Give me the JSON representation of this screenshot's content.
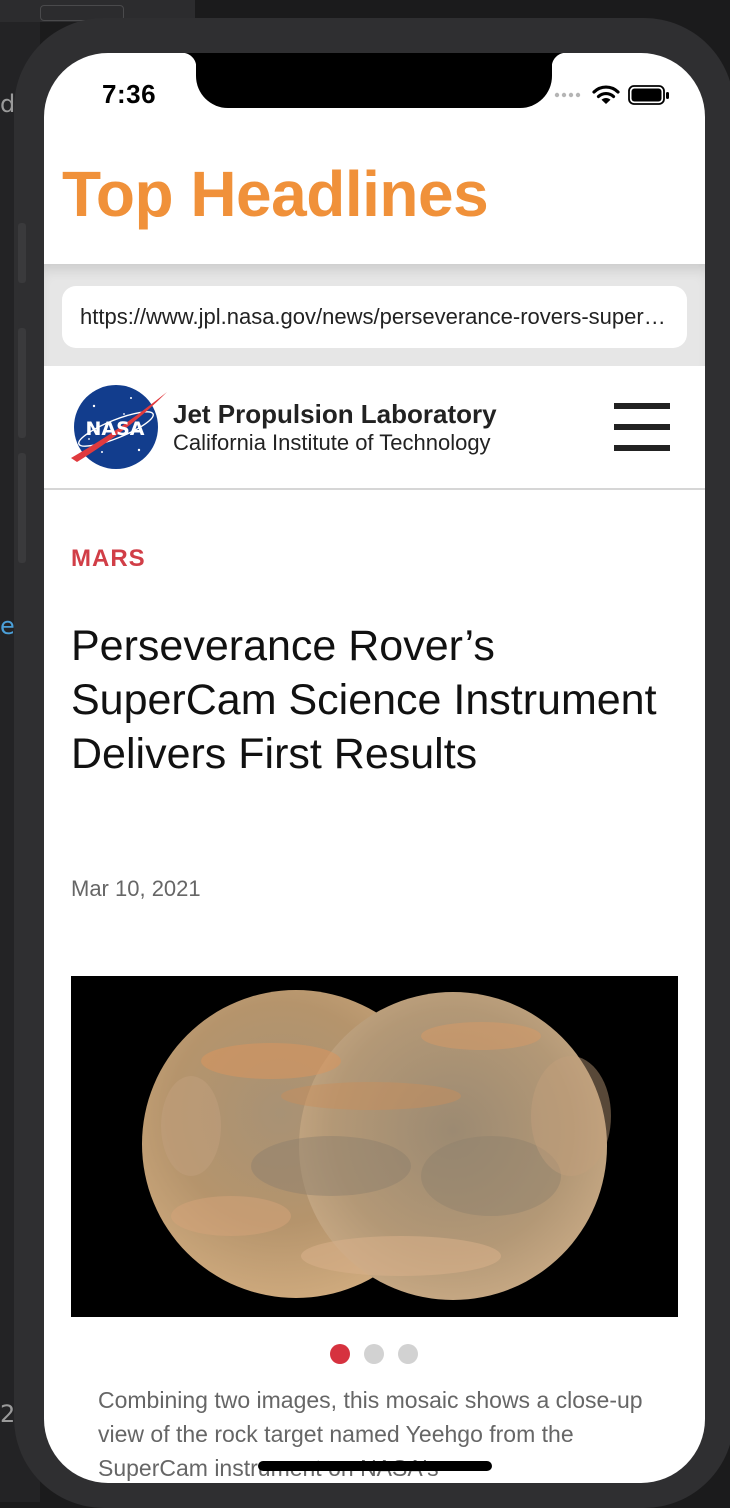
{
  "status_bar": {
    "time": "7:36"
  },
  "app": {
    "title": "Top Headlines"
  },
  "browser": {
    "url": "https://www.jpl.nasa.gov/news/perseverance-rovers-supercam-science-instrument-delivers-first-results"
  },
  "site_header": {
    "logo_text": "NASA",
    "title": "Jet Propulsion Laboratory",
    "subtitle": "California Institute of Technology"
  },
  "article": {
    "category": "MARS",
    "headline": "Perseverance Rover’s SuperCam Science Instrument Delivers First Results",
    "date": "Mar 10, 2021",
    "caption": "Combining two images, this mosaic shows a close-up view of the rock target named Yeehgo from the SuperCam instrument on NASA's",
    "carousel": {
      "count": 3,
      "active_index": 0
    }
  },
  "colors": {
    "title_accent": "#f0913a",
    "category_red": "#d13e47",
    "carousel_active": "#d6323f",
    "carousel_inactive": "#d2d2d2"
  },
  "icons": [
    "wifi-icon",
    "battery-icon",
    "cellular-signal-icon",
    "nasa-logo",
    "hamburger-menu-icon"
  ]
}
